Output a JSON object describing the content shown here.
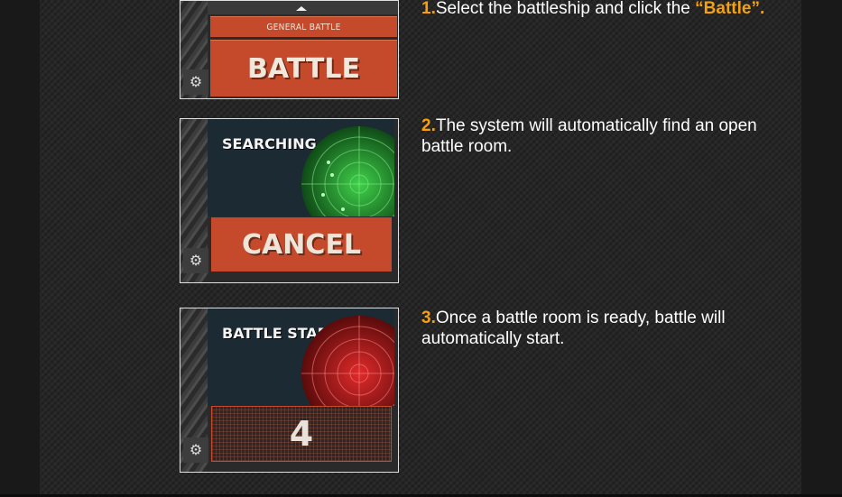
{
  "steps": [
    {
      "number": "1.",
      "text": "Select the battleship and click the ",
      "highlight": "“Battle”."
    },
    {
      "number": "2.",
      "text": "The system will automatically find an open battle room."
    },
    {
      "number": "3.",
      "text": "Once a battle room is ready, battle will automatically start."
    }
  ],
  "screens": {
    "general": {
      "mode_label": "GENERAL BATTLE",
      "button_label": "BATTLE",
      "settings_icon": "gear-icon"
    },
    "searching": {
      "title": "SEARCHING",
      "button_label": "CANCEL",
      "radar_color": "#2fa838",
      "settings_icon": "gear-icon"
    },
    "start": {
      "title": "BATTLE START",
      "countdown": "4",
      "radar_color": "#cc1f1f",
      "settings_icon": "gear-icon"
    }
  },
  "colors": {
    "accent": "#f5a012",
    "button": "#c44a2b"
  }
}
